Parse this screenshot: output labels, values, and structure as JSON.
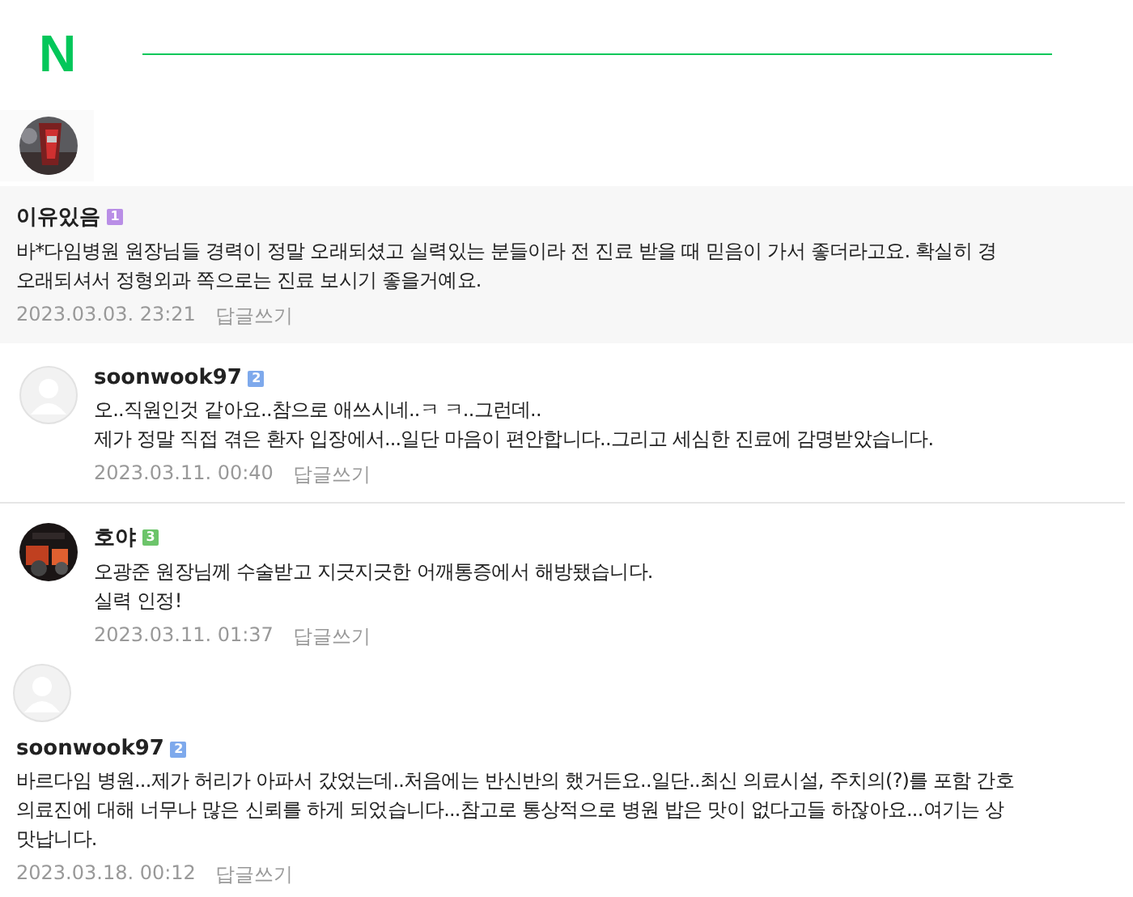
{
  "header": {
    "logo": "N"
  },
  "comments": [
    {
      "kind": "top",
      "avatar": {
        "kind": "picture"
      },
      "name": "이유있음",
      "badge": {
        "text": "1",
        "color": "#b98ee6"
      },
      "lines": [
        "바*다임병원 원장님들 경력이 정말 오래되셨고 실력있는 분들이라 전 진료 받을 때 믿음이 가서 좋더라고요. 확실히 경",
        "오래되셔서 정형외과 쪽으로는 진료 보시기 좋을거예요."
      ],
      "date": "2023.03.03. 23:21",
      "reply": "답글쓰기"
    },
    {
      "kind": "reply",
      "avatar": {
        "kind": "default"
      },
      "name": "soonwook97",
      "badge": {
        "text": "2",
        "color": "#7ea9ec"
      },
      "lines": [
        "오..직원인것 같아요..참으로 애쓰시네..ㅋ ㅋ..그런데..",
        "제가 정말 직접 겪은 환자 입장에서...일단 마음이 편안합니다..그리고 세심한 진료에 감명받았습니다."
      ],
      "date": "2023.03.11. 00:40",
      "reply": "답글쓰기"
    },
    {
      "kind": "reply",
      "avatar": {
        "kind": "picture"
      },
      "name": "호야",
      "badge": {
        "text": "3",
        "color": "#6cc46a"
      },
      "lines": [
        "오광준 원장님께 수술받고 지긋지긋한 어깨통증에서 해방됐습니다.",
        "실력 인정!"
      ],
      "date": "2023.03.11. 01:37",
      "reply": "답글쓰기"
    },
    {
      "kind": "top",
      "avatar": {
        "kind": "default"
      },
      "name": "soonwook97",
      "badge": {
        "text": "2",
        "color": "#7ea9ec"
      },
      "lines": [
        "바르다임 병원...제가 허리가 아파서 갔었는데..처음에는 반신반의 했거든요..일단..최신 의료시설, 주치의(?)를 포함 간호",
        "의료진에 대해 너무나 많은 신뢰를 하게 되었습니다...참고로 통상적으로 병원 밥은 맛이 없다고들 하잖아요...여기는 상",
        "맛납니다."
      ],
      "date": "2023.03.18. 00:12",
      "reply": "답글쓰기"
    }
  ]
}
